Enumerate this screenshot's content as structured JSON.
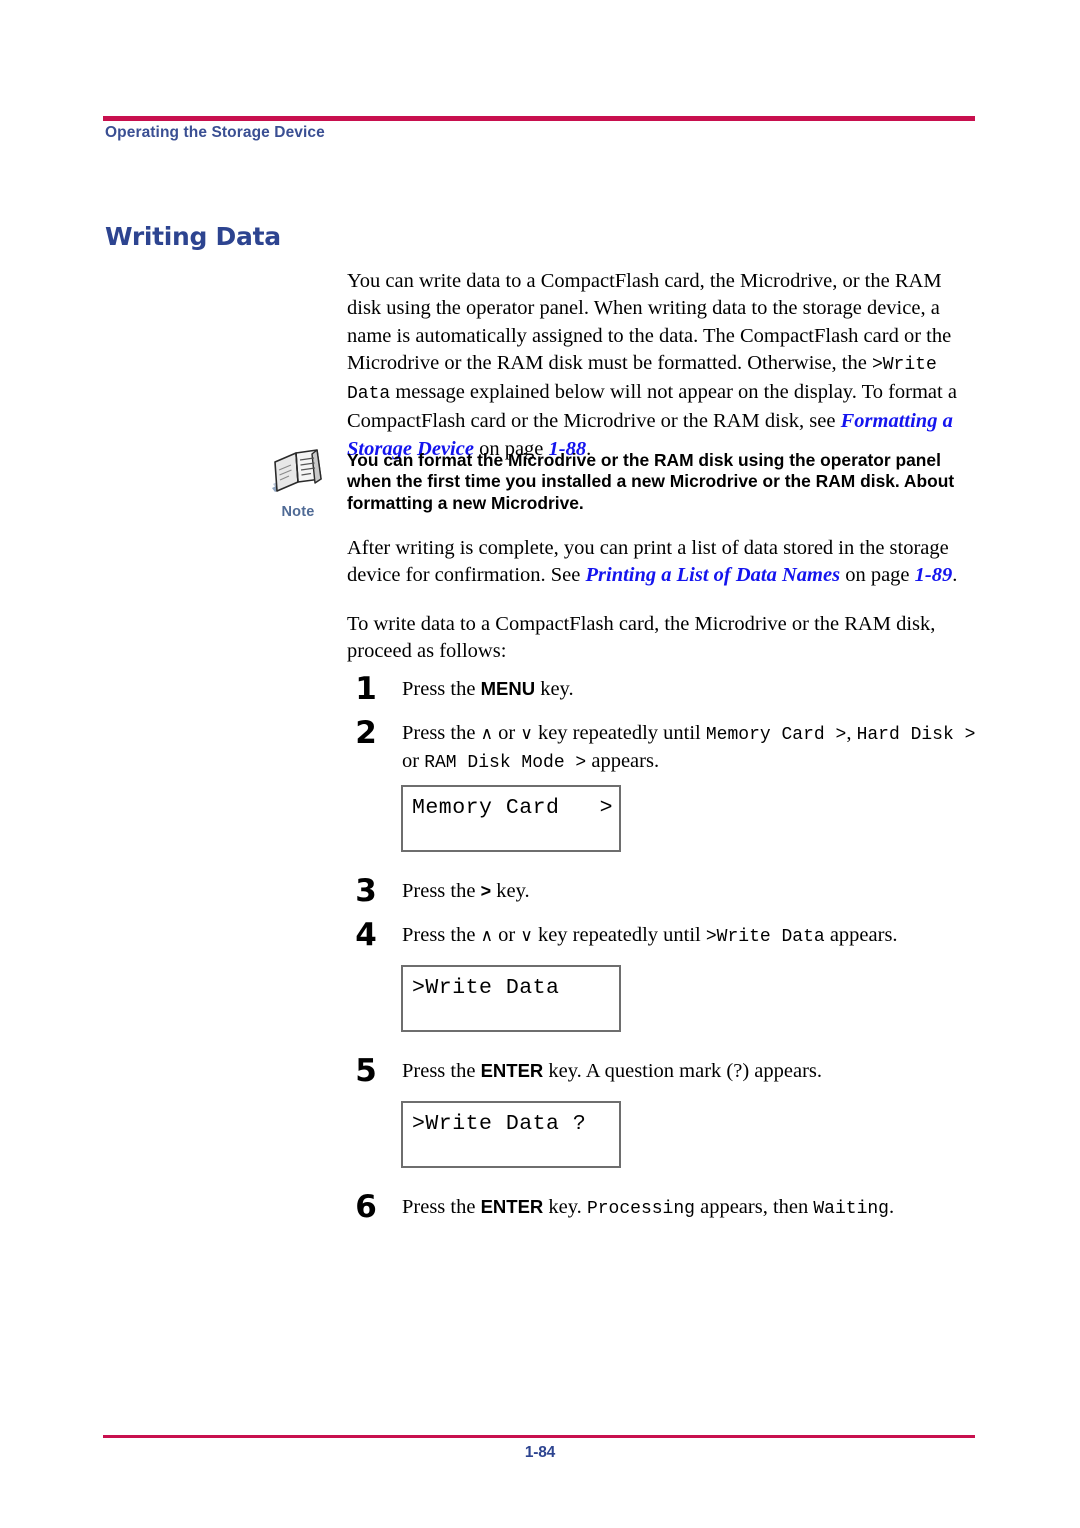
{
  "header": {
    "running_title": "Operating the Storage Device",
    "rule_color": "#C8104E",
    "title_color": "#3A4F93"
  },
  "section": {
    "heading": "Writing Data",
    "heading_color": "#2D4490"
  },
  "intro_paragraph": {
    "part1": "You can write data to a CompactFlash card, the Microdrive, or the RAM disk using the operator panel. When writing data to the storage device, a name is automatically assigned to the data. The CompactFlash card or the Microdrive or the RAM disk must be formatted. Otherwise, the ",
    "mono1": ">Write Data",
    "part2": " message explained below will not appear on the display. To format a CompactFlash card or the Microdrive or the RAM disk, see ",
    "link1": "Formatting a Storage Device",
    "part3": " on page ",
    "link_page1": "1-88",
    "part4": "."
  },
  "note": {
    "icon_name": "note-document-icon",
    "label": "Note",
    "label_color": "#4F6A95",
    "text": "You can format the Microdrive or the RAM disk using the operator panel when the first time you installed a new Microdrive or the RAM disk. About formatting a new Microdrive."
  },
  "after_note_paragraph": {
    "part1": "After writing is complete, you can print a list of data stored in the storage device for confirmation. See ",
    "link1": "Printing a List of Data Names",
    "part2": " on page ",
    "link_page1": "1-89",
    "part3": "."
  },
  "lead_in_paragraph": {
    "text": "To write data to a CompactFlash card, the Microdrive or the RAM disk, proceed as follows:"
  },
  "steps": [
    {
      "number": "1",
      "prefix": "Press the ",
      "key": "MENU",
      "suffix": " key."
    },
    {
      "number": "2",
      "prefix": "Press the ",
      "key_up": "∧",
      "mid1": " or ",
      "key_down": "∨",
      "mid2": " key repeatedly until ",
      "mono1": "Memory Card >",
      "mid3": ", ",
      "mono2": "Hard Disk >",
      "mid4": " or ",
      "mono3": "RAM Disk Mode >",
      "suffix": " appears."
    },
    {
      "number": "3",
      "prefix": "Press the ",
      "key": ">",
      "suffix": " key."
    },
    {
      "number": "4",
      "prefix": "Press the ",
      "key_up": "∧",
      "mid1": " or ",
      "key_down": "∨",
      "mid2": " key repeatedly until ",
      "mono1": ">Write Data",
      "suffix": " appears."
    },
    {
      "number": "5",
      "prefix": "Press the ",
      "key": "ENTER",
      "suffix": " key. A question mark (?) appears."
    },
    {
      "number": "6",
      "prefix": "Press the ",
      "key": "ENTER",
      "mid1": " key. ",
      "mono1": "Processing",
      "mid2": " appears, then ",
      "mono2": "Waiting",
      "suffix": "."
    }
  ],
  "lcd_panels": [
    {
      "line": "Memory Card   >"
    },
    {
      "line": ">Write Data"
    },
    {
      "line": ">Write Data ?"
    }
  ],
  "footer": {
    "page_number": "1-84",
    "rule_color": "#C8104E"
  }
}
